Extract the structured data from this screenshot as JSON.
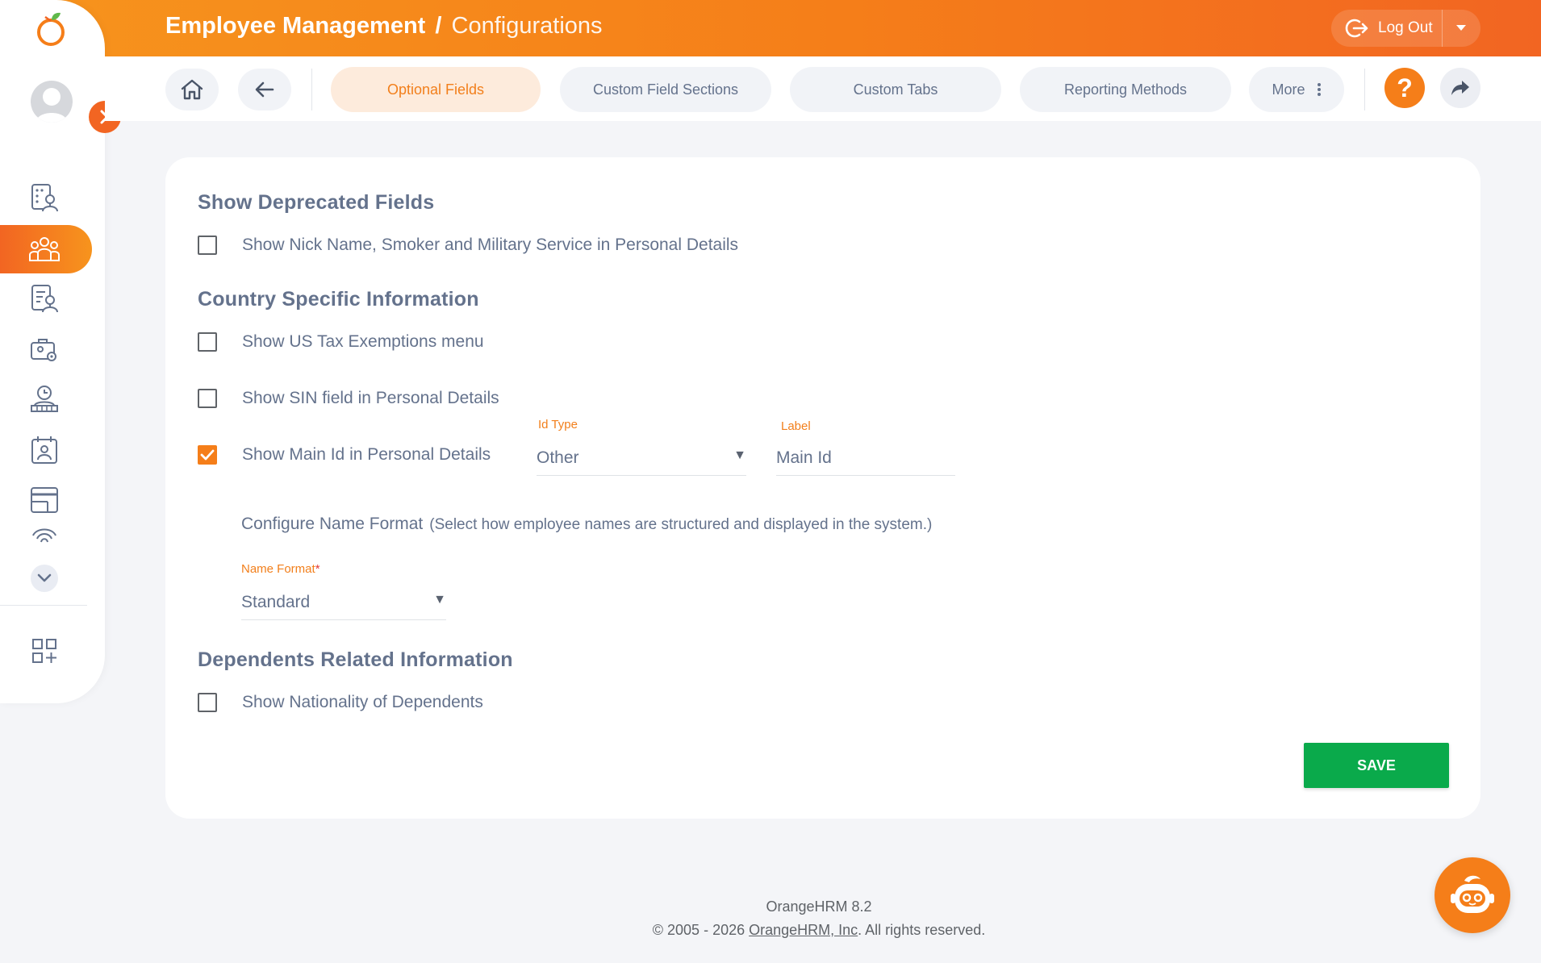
{
  "header": {
    "module": "Employee Management",
    "separator": "/",
    "page": "Configurations",
    "logout_label": "Log Out"
  },
  "toolbar": {
    "tabs": [
      {
        "label": "Optional Fields",
        "active": true
      },
      {
        "label": "Custom Field Sections",
        "active": false
      },
      {
        "label": "Custom Tabs",
        "active": false
      },
      {
        "label": "Reporting Methods",
        "active": false
      },
      {
        "label": "More",
        "active": false
      }
    ],
    "help_symbol": "?"
  },
  "form": {
    "deprecated": {
      "title": "Show Deprecated Fields",
      "nick_name": {
        "label": "Show Nick Name, Smoker and Military Service in Personal Details",
        "checked": false
      }
    },
    "country": {
      "title": "Country Specific Information",
      "us_tax": {
        "label": "Show US Tax Exemptions menu",
        "checked": false
      },
      "sin": {
        "label": "Show SIN field in Personal Details",
        "checked": false
      },
      "main_id": {
        "label": "Show Main Id in Personal Details",
        "checked": true
      },
      "id_type": {
        "label": "Id Type",
        "value": "Other"
      },
      "id_label": {
        "label": "Label",
        "value": "Main Id"
      },
      "name_format_title": "Configure Name Format",
      "name_format_desc": "(Select how employee names are structured and displayed in the system.)",
      "name_format": {
        "label": "Name Format",
        "required_mark": "*",
        "value": "Standard"
      }
    },
    "dependents": {
      "title": "Dependents Related Information",
      "nationality": {
        "label": "Show Nationality of Dependents",
        "checked": false
      }
    },
    "save_label": "SAVE"
  },
  "footer": {
    "version": "OrangeHRM 8.2",
    "copyright_prefix": "© 2005 - 2026 ",
    "company_link": "OrangeHRM, Inc",
    "copyright_suffix": ". All rights reserved."
  },
  "colors": {
    "brand_orange": "#f57e19",
    "save_green": "#0aaa4b",
    "text": "#64728c"
  },
  "icons": {
    "sidebar": [
      "directory-icon",
      "employee-management-icon",
      "reports-icon",
      "recruitment-icon",
      "time-icon",
      "leave-icon",
      "payroll-icon",
      "biometrics-icon"
    ],
    "toolbar": [
      "home-icon",
      "back-arrow-icon",
      "kebab-menu-icon",
      "help-icon",
      "share-icon"
    ]
  }
}
